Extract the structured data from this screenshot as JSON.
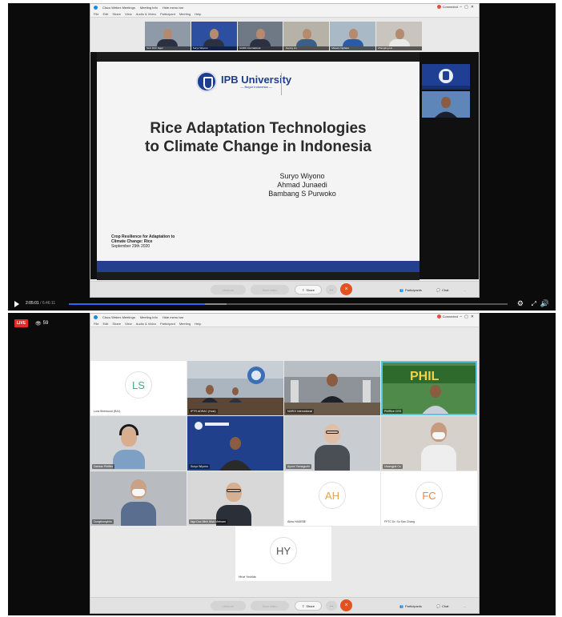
{
  "player1": {
    "webex": {
      "title_items": [
        "Cisco Webex Meetings",
        "Meeting Info",
        "Hide menu bar"
      ],
      "connection": "Connected",
      "menu": [
        "File",
        "Edit",
        "Share",
        "View",
        "Audio & Video",
        "Participant",
        "Meeting",
        "Help"
      ],
      "strip_names": [
        "Sinh Dinh Ngoc",
        "Suryo Wiyono",
        "NARDI International",
        "Jiuping Liu",
        "Masaru Ogihara",
        "Zhangting Hu"
      ],
      "slide": {
        "logo_name": "IPB University",
        "logo_sub": "— Bogor Indonesia —",
        "title_line1": "Rice Adaptation Technologies",
        "title_line2": "to Climate Change in Indonesia",
        "authors": [
          "Suryo Wiyono",
          "Ahmad Junaedi",
          "Bambang S Purwoko"
        ],
        "footnote_line1": "Crop Resilience for Adaptation to",
        "footnote_line2": "Climate Change: Rice",
        "footnote_line3": "September 29th 2020"
      },
      "toolbar": {
        "mute": "Unmute",
        "video": "Start video",
        "share": "Share",
        "more": "...",
        "end": "×",
        "participants": "Participants",
        "chat": "Chat",
        "overflow": "..."
      }
    },
    "controls": {
      "current_time": "2:05:01",
      "duration": "6:46:11",
      "progress": 0.31,
      "buffered": 0.36
    }
  },
  "player2": {
    "live_label": "LIVE",
    "viewer_count": "59",
    "webex": {
      "title_items": [
        "Cisco Webex Meetings",
        "Meeting Info",
        "Hide menu bar"
      ],
      "connection": "Connected",
      "menu": [
        "File",
        "Edit",
        "Share",
        "View",
        "Audio & Video",
        "Participant",
        "Meeting",
        "Help"
      ],
      "tiles": [
        {
          "initials": "LS",
          "name": "Lora Sherwood (RAI)",
          "kind": "avatar",
          "color": "#38b27a"
        },
        {
          "name": "IPTR ADRAC (Host)",
          "kind": "video"
        },
        {
          "name": "NARDI International",
          "kind": "video"
        },
        {
          "name": "PhilRice CES",
          "kind": "video"
        },
        {
          "name": "Damian Pfeiffer",
          "kind": "video"
        },
        {
          "name": "Suryo Wiyono",
          "kind": "video"
        },
        {
          "name": "Ayumi Yamaguchi",
          "kind": "video"
        },
        {
          "name": "Uwangjuk Cs",
          "kind": "video"
        },
        {
          "name": "Dongthonghim",
          "kind": "video"
        },
        {
          "name": "Ngo Duc Minh MoA Vietnam",
          "kind": "video"
        },
        {
          "initials": "AH",
          "name": "Akira HASEBE",
          "kind": "avatar",
          "color": "#e8a33a"
        },
        {
          "initials": "FC",
          "name": "FFTC Dr. Su San Chang",
          "kind": "avatar",
          "color": "#e8863a"
        },
        {
          "initials": "HY",
          "name": "Hiroe Yoshida",
          "kind": "avatar",
          "color": "#555555"
        }
      ],
      "toolbar": {
        "mute": "Unmute",
        "video": "Start video",
        "share": "Share",
        "more": "...",
        "end": "×",
        "participants": "Participants",
        "chat": "Chat",
        "overflow": "..."
      }
    }
  }
}
